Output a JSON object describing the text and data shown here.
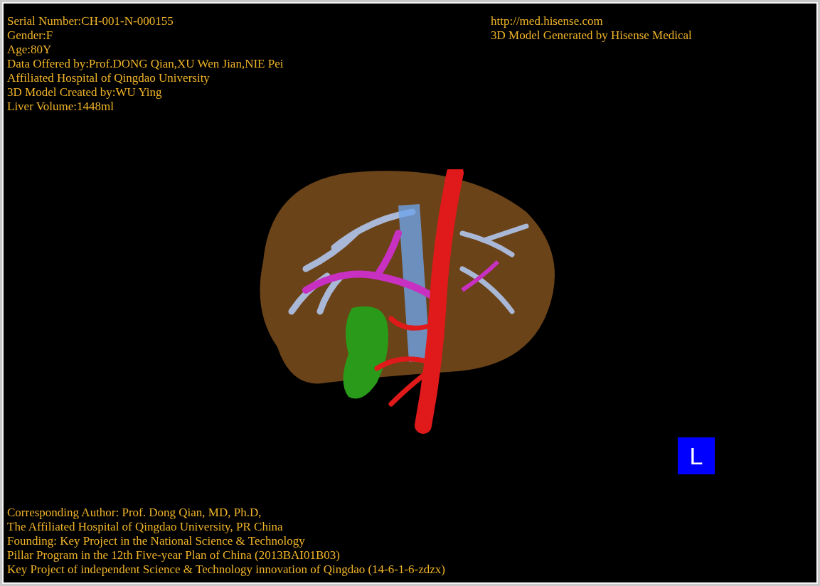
{
  "patient_info": [
    "Serial Number:CH-001-N-000155",
    "Gender:F",
    "Age:80Y",
    "Data Offered by:Prof.DONG Qian,XU Wen Jian,NIE Pei",
    "Affiliated Hospital of Qingdao University",
    "3D Model Created by:WU Ying",
    "Liver Volume:1448ml"
  ],
  "brand_info": {
    "url": "http://med.hisense.com",
    "caption": "3D Model Generated by Hisense Medical"
  },
  "orientation_marker": "L",
  "credits": [
    "Corresponding Author: Prof. Dong Qian, MD, Ph.D,",
    "The Affiliated Hospital of Qingdao University, PR China",
    "Founding: Key Project in the National Science & Technology",
    "Pillar Program in the 12th Five-year Plan of China (2013BAI01B03)",
    "Key Project of independent Science & Technology innovation of Qingdao (14-6-1-6-zdzx)"
  ]
}
